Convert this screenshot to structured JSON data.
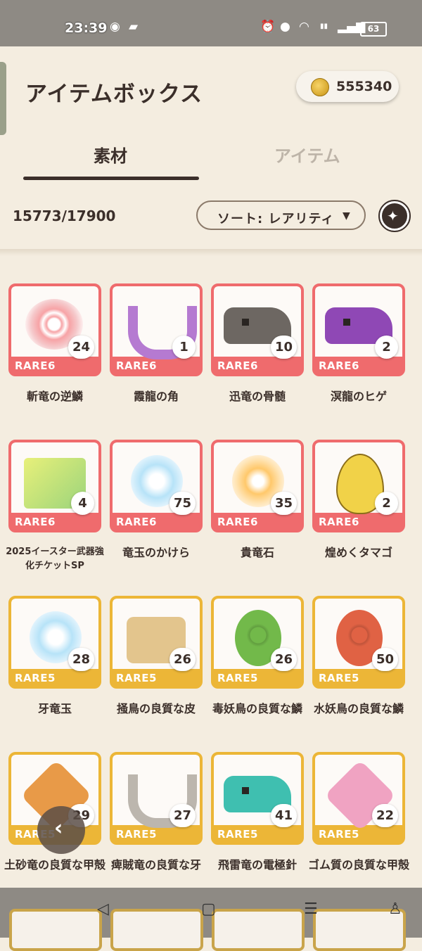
{
  "status_bar": {
    "time": "23:39",
    "left_icons": [
      "chat-icon",
      "app-icon"
    ],
    "right_icons": [
      "alarm-icon",
      "location-icon",
      "wifi-icon",
      "volte-icon",
      "signal-icon"
    ],
    "battery": "63"
  },
  "header": {
    "title": "アイテムボックス",
    "currency": "555340"
  },
  "tabs": [
    {
      "label": "素材",
      "active": true
    },
    {
      "label": "アイテム",
      "active": false
    }
  ],
  "toolbar": {
    "count": "15773/17900",
    "sort_label": "ソート: レアリティ",
    "sort_arrow": "▼"
  },
  "items": [
    {
      "name": "斬竜の逆鱗",
      "rarity": "RARE6",
      "qty": "24",
      "icon": "scale-icon"
    },
    {
      "name": "霞龍の角",
      "rarity": "RARE6",
      "qty": "1",
      "icon": "horn-icon"
    },
    {
      "name": "迅竜の骨髄",
      "rarity": "RARE6",
      "qty": "10",
      "icon": "dragon-skull-icon"
    },
    {
      "name": "溟龍のヒゲ",
      "rarity": "RARE6",
      "qty": "2",
      "icon": "dragon-head-icon"
    },
    {
      "name": "2025イースター武器強化チケットSP",
      "rarity": "RARE6",
      "qty": "4",
      "icon": "ticket-icon"
    },
    {
      "name": "竜玉のかけら",
      "rarity": "RARE6",
      "qty": "75",
      "icon": "gem-icon"
    },
    {
      "name": "貴竜石",
      "rarity": "RARE6",
      "qty": "35",
      "icon": "sun-stone-icon"
    },
    {
      "name": "煌めくタマゴ",
      "rarity": "RARE6",
      "qty": "2",
      "icon": "egg-icon"
    },
    {
      "name": "牙竜玉",
      "rarity": "RARE5",
      "qty": "28",
      "icon": "gem-icon"
    },
    {
      "name": "掻鳥の良質な皮",
      "rarity": "RARE5",
      "qty": "26",
      "icon": "pelt-icon"
    },
    {
      "name": "毒妖鳥の良質な鱗",
      "rarity": "RARE5",
      "qty": "26",
      "icon": "shell-icon"
    },
    {
      "name": "水妖鳥の良質な鱗",
      "rarity": "RARE5",
      "qty": "50",
      "icon": "shell-icon"
    },
    {
      "name": "土砂竜の良質な甲殻",
      "rarity": "RARE5",
      "qty": "29",
      "icon": "carapace-icon"
    },
    {
      "name": "痺賊竜の良質な牙",
      "rarity": "RARE5",
      "qty": "27",
      "icon": "fang-icon"
    },
    {
      "name": "飛雷竜の電極針",
      "rarity": "RARE5",
      "qty": "41",
      "icon": "dragon-head-icon"
    },
    {
      "name": "ゴム質の良質な甲殻",
      "rarity": "RARE5",
      "qty": "22",
      "icon": "carapace-icon"
    }
  ],
  "colors": {
    "rare6": "#ef6b6d",
    "rare5": "#ecb637",
    "background": "#f4ede0",
    "text": "#3b2f2a"
  }
}
